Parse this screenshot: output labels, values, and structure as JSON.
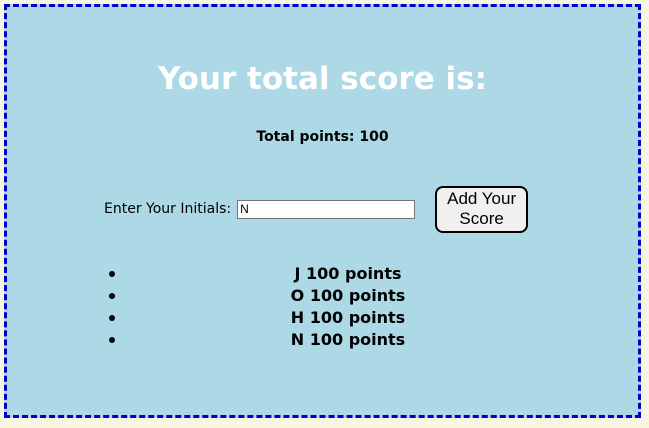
{
  "header": {
    "title": "Your total score is:"
  },
  "summary": {
    "total_points": "Total points: 100"
  },
  "form": {
    "label": "Enter Your Initials:",
    "input_value": "N",
    "button_label_line1": "Add Your",
    "button_label_line2": "Score"
  },
  "scores": [
    {
      "text": "J 100 points"
    },
    {
      "text": "O 100 points"
    },
    {
      "text": "H 100 points"
    },
    {
      "text": "N 100 points"
    }
  ],
  "colors": {
    "panel_background": "#add8e6",
    "panel_border": "#0000cd",
    "page_background": "#f5f5e1",
    "title_text": "#ffffff"
  }
}
